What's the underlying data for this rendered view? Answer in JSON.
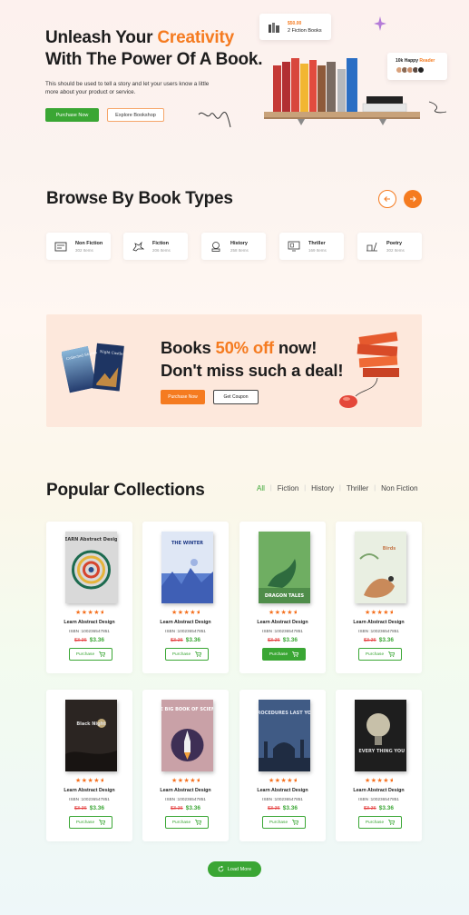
{
  "hero": {
    "title_line1_a": "Unleash Your ",
    "title_line1_b": "Creativity",
    "title_line2": "With The Power Of A Book.",
    "description": "This should be used to tell a story and let your users know a little more about your product or service.",
    "purchase_label": "Purchase Now",
    "explore_label": "Explore Bookshop",
    "badge_books_price": "$50.00",
    "badge_books_label": "2 Fiction Books",
    "badge_readers_a": "10k Happy ",
    "badge_readers_b": "Reader"
  },
  "browse": {
    "title": "Browse By Book Types",
    "types": [
      {
        "name": "Non Fiction",
        "count": "302 Items",
        "icon": "newspaper-icon"
      },
      {
        "name": "Fiction",
        "count": "206 Items",
        "icon": "dragon-icon"
      },
      {
        "name": "History",
        "count": "258 Items",
        "icon": "globe-book-icon"
      },
      {
        "name": "Thriller",
        "count": "169 Items",
        "icon": "monitor-book-icon"
      },
      {
        "name": "Poetry",
        "count": "302 Items",
        "icon": "quill-book-icon"
      }
    ]
  },
  "promo": {
    "line1_a": "Books ",
    "line1_b": "50% off",
    "line1_c": " now!",
    "line2": "Don't miss such a deal!",
    "purchase_label": "Purchase Now",
    "coupon_label": "Get Coupon",
    "cover_text_1": "Collected Stories",
    "cover_text_2": "Night Castle"
  },
  "collections": {
    "title": "Popular Collections",
    "filters": [
      "All",
      "Fiction",
      "History",
      "Thriller",
      "Non Fiction"
    ],
    "active_filter": "All",
    "books": [
      {
        "cover": "maze",
        "cover_text": "LEARN Abstract Design",
        "title": "Learn Abstract Design",
        "isbn": "ISBN :100236547851",
        "old_price": "$3.36",
        "new_price": "$3.36",
        "button": "Purchase",
        "rating": 4.5
      },
      {
        "cover": "winter",
        "cover_text": "THE WINTER",
        "title": "Learn Abstract Design",
        "isbn": "ISBN :100236547851",
        "old_price": "$3.36",
        "new_price": "$3.36",
        "button": "Purchase",
        "rating": 4.5
      },
      {
        "cover": "dragon",
        "cover_text": "DRAGON TALES",
        "title": "Learn Abstract Design",
        "isbn": "ISBN :100236547851",
        "old_price": "$3.36",
        "new_price": "$3.36",
        "button": "Purchase",
        "rating": 4.5
      },
      {
        "cover": "birds",
        "cover_text": "Birds",
        "title": "Learn Abstract Design",
        "isbn": "ISBN :100236547851",
        "old_price": "$3.36",
        "new_price": "$3.36",
        "button": "Purchase",
        "rating": 4.5
      },
      {
        "cover": "night",
        "cover_text": "Black Night",
        "title": "Learn Abstract Design",
        "isbn": "ISBN :100236547851",
        "old_price": "$3.36",
        "new_price": "$3.36",
        "button": "Purchase",
        "rating": 4.5
      },
      {
        "cover": "science",
        "cover_text": "THE BIG BOOK OF SCIENCE",
        "title": "Learn Abstract Design",
        "isbn": "ISBN :100236547851",
        "old_price": "$3.36",
        "new_price": "$3.36",
        "button": "Purchase",
        "rating": 4.5
      },
      {
        "cover": "mosque",
        "cover_text": "PROCEDURES LAST YOU",
        "title": "Learn Abstract Design",
        "isbn": "ISBN :100236547851",
        "old_price": "$3.36",
        "new_price": "$3.36",
        "button": "Purchase",
        "rating": 4.5
      },
      {
        "cover": "bulb",
        "cover_text": "EVERY THING YOU NEVER",
        "title": "Learn Abstract Design",
        "isbn": "ISBN :100236547851",
        "old_price": "$3.36",
        "new_price": "$3.36",
        "button": "Purchase",
        "rating": 4.5
      }
    ],
    "highlighted_button_index": 2,
    "load_more_label": "Load More"
  },
  "colors": {
    "accent_orange": "#f57b20",
    "accent_green": "#3aa634",
    "price_red": "#e43b3b"
  }
}
